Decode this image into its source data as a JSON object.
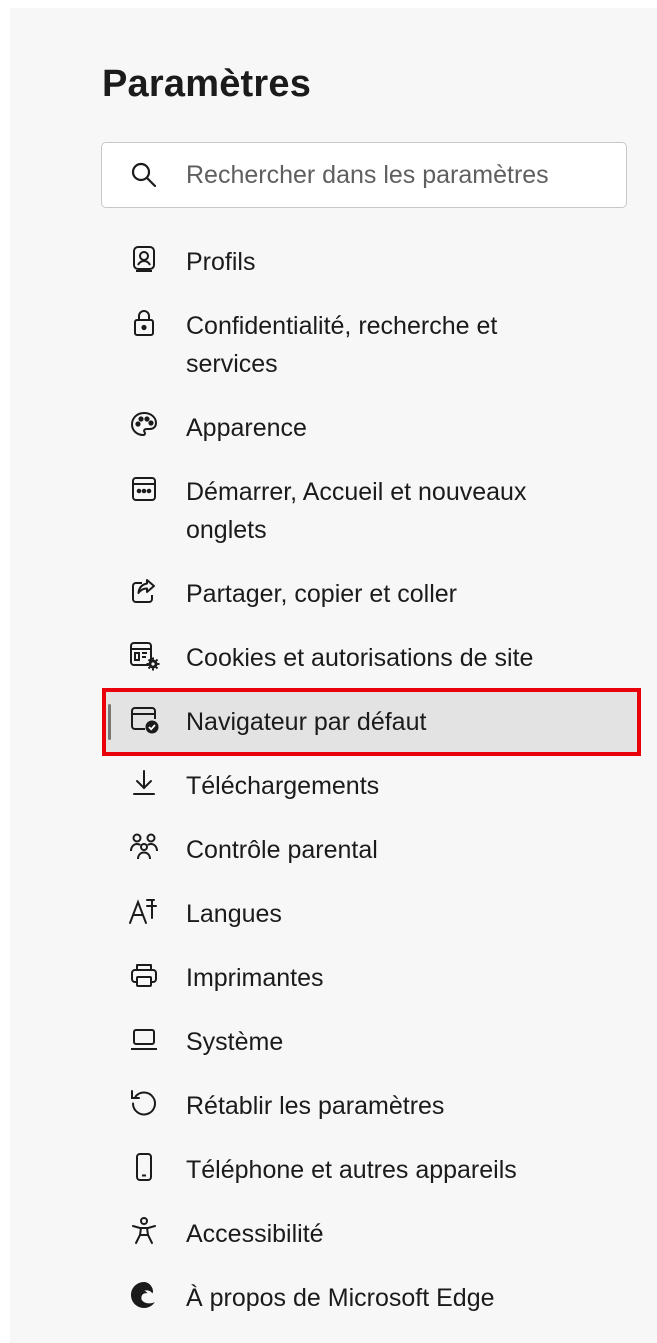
{
  "header": {
    "title": "Paramètres"
  },
  "search": {
    "placeholder": "Rechercher dans les paramètres",
    "icon": "search-icon"
  },
  "sidebar": {
    "items": [
      {
        "label": "Profils",
        "icon": "profile-icon"
      },
      {
        "label": "Confidentialité, recherche et services",
        "icon": "lock-icon"
      },
      {
        "label": "Apparence",
        "icon": "palette-icon"
      },
      {
        "label": "Démarrer, Accueil et nouveaux onglets",
        "icon": "home-tabs-icon"
      },
      {
        "label": "Partager, copier et coller",
        "icon": "share-icon"
      },
      {
        "label": "Cookies et autorisations de site",
        "icon": "site-permissions-icon"
      },
      {
        "label": "Navigateur par défaut",
        "icon": "default-browser-icon",
        "selected": true
      },
      {
        "label": "Téléchargements",
        "icon": "download-icon"
      },
      {
        "label": "Contrôle parental",
        "icon": "family-icon"
      },
      {
        "label": "Langues",
        "icon": "language-icon"
      },
      {
        "label": "Imprimantes",
        "icon": "printer-icon"
      },
      {
        "label": "Système",
        "icon": "laptop-icon"
      },
      {
        "label": "Rétablir les paramètres",
        "icon": "reset-icon"
      },
      {
        "label": "Téléphone et autres appareils",
        "icon": "phone-icon"
      },
      {
        "label": "Accessibilité",
        "icon": "accessibility-icon"
      },
      {
        "label": "À propos de Microsoft Edge",
        "icon": "edge-logo-icon"
      }
    ]
  },
  "colors": {
    "highlight_border": "#e8000a",
    "selected_bg": "#e3e3e3",
    "panel_bg": "#f7f7f7"
  }
}
